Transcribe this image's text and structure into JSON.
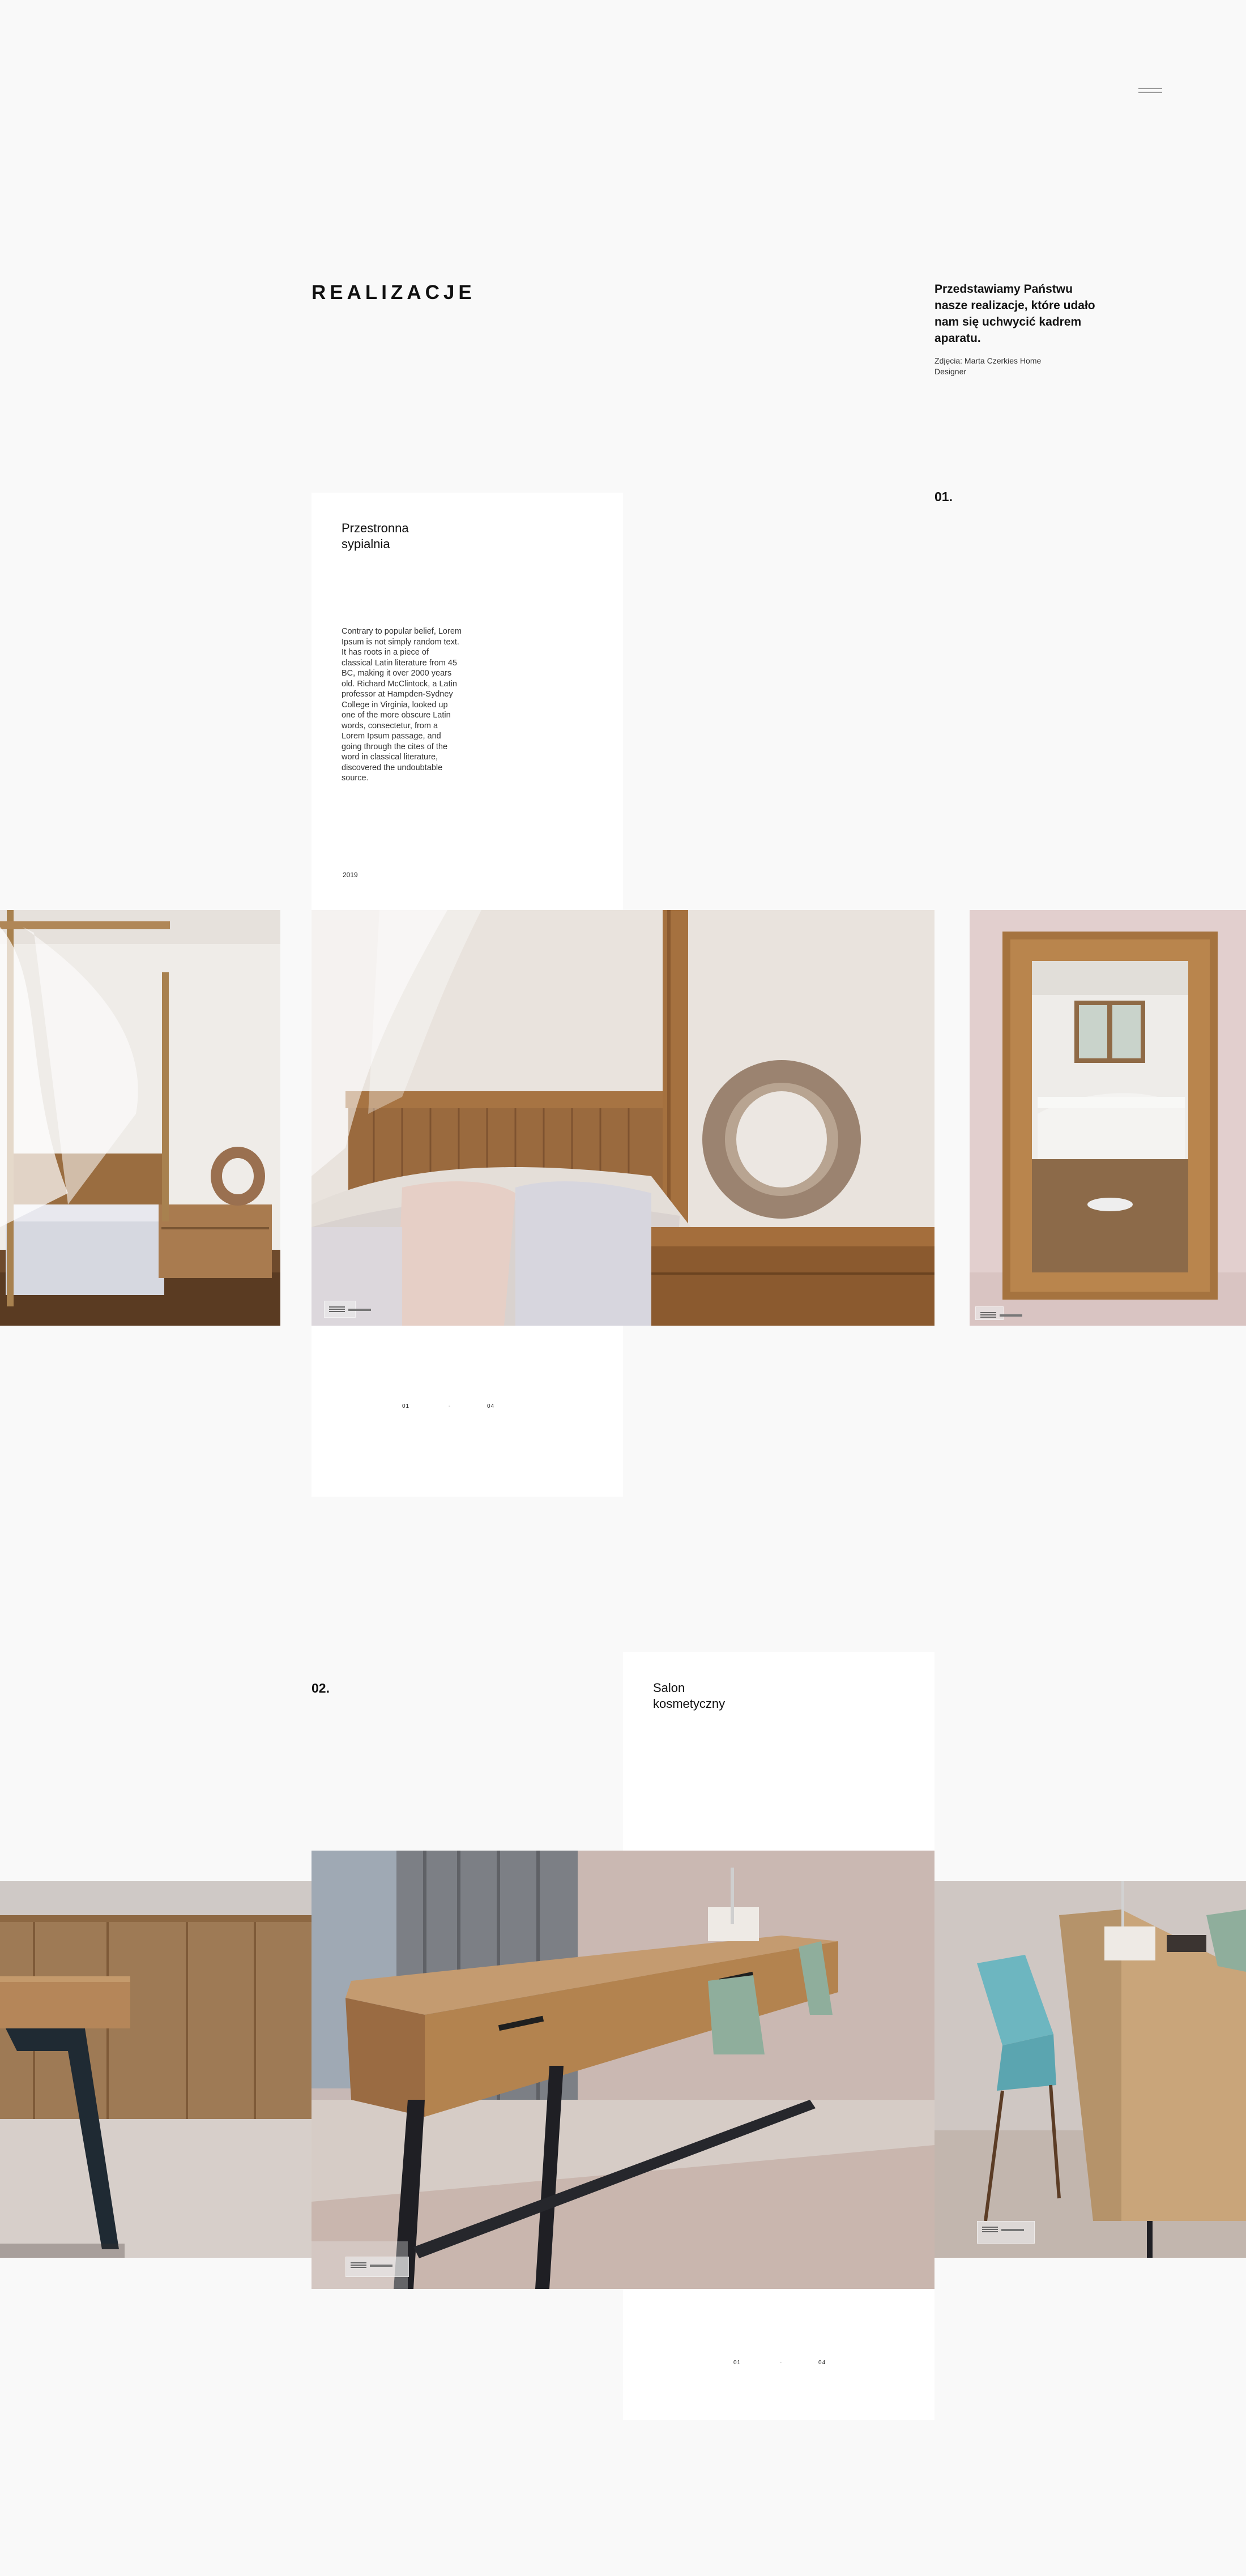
{
  "header": {
    "menu_icon": "hamburger-icon"
  },
  "page": {
    "title": "REALIZACJE",
    "intro": "Przedstawiamy Państwu nasze realizacje, które udało nam się uchwycić kadrem aparatu.",
    "credit": "Zdjęcia: Marta Czerkies Home Designer"
  },
  "projects": [
    {
      "number": "01.",
      "title": "Przestronna sypialnia",
      "description": "Contrary to popular belief, Lorem Ipsum is not simply random text. It has roots in a piece of classical Latin literature from 45 BC, making it over 2000 years old. Richard McClintock, a Latin professor at Hampden-Sydney College in Virginia, looked up one of the more obscure Latin words, consectetur, from a Lorem Ipsum passage, and going through the cites of the word in classical literature, discovered the undoubtable source.",
      "year": "2019",
      "pager": {
        "current": "01",
        "separator": "-",
        "total": "04"
      }
    },
    {
      "number": "02.",
      "title": "Salon kosmetyczny",
      "pager": {
        "current": "01",
        "separator": "-",
        "total": "04"
      }
    }
  ]
}
